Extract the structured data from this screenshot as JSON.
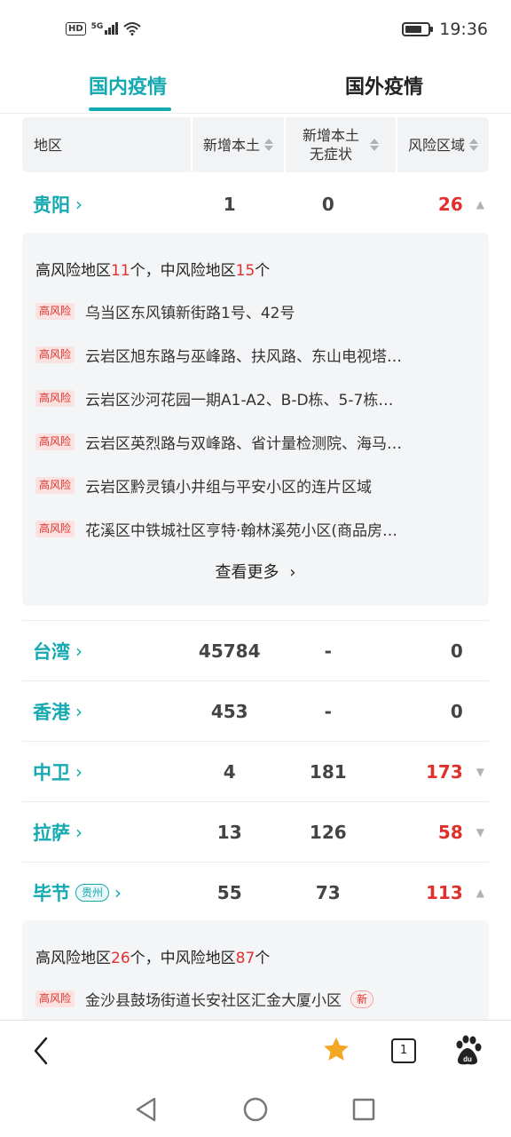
{
  "status_bar": {
    "hd": "HD",
    "network": "5G",
    "time": "19:36",
    "battery_level": 0.75
  },
  "tabs": [
    {
      "label": "国内疫情",
      "active": true
    },
    {
      "label": "国外疫情",
      "active": false
    }
  ],
  "table_header": {
    "region": "地区",
    "new_local": "新增本土",
    "new_asymptomatic_line1": "新增本土",
    "new_asymptomatic_line2": "无症状",
    "risk_areas": "风险区域"
  },
  "rows": [
    {
      "region": "贵阳",
      "new_local": "1",
      "asymptomatic": "0",
      "risk": "26",
      "risk_red": true,
      "expanded": true
    },
    {
      "region": "台湾",
      "new_local": "45784",
      "asymptomatic": "-",
      "risk": "0",
      "risk_red": false
    },
    {
      "region": "香港",
      "new_local": "453",
      "asymptomatic": "-",
      "risk": "0",
      "risk_red": false
    },
    {
      "region": "中卫",
      "new_local": "4",
      "asymptomatic": "181",
      "risk": "173",
      "risk_red": true
    },
    {
      "region": "拉萨",
      "new_local": "13",
      "asymptomatic": "126",
      "risk": "58",
      "risk_red": true
    },
    {
      "region": "毕节",
      "province_tag": "贵州",
      "new_local": "55",
      "asymptomatic": "73",
      "risk": "113",
      "risk_red": true,
      "expanded": true
    }
  ],
  "guiyang_panel": {
    "summary_prefix": "高风险地区",
    "high_count": "11",
    "summary_mid": "个，中风险地区",
    "mid_count": "15",
    "summary_suffix": "个",
    "badge": "高风险",
    "items": [
      "乌当区东风镇新街路1号、42号",
      "云岩区旭东路与巫峰路、扶风路、东山电视塔…",
      "云岩区沙河花园一期A1-A2、B-D栋、5-7栋…",
      "云岩区英烈路与双峰路、省计量检测院、海马…",
      "云岩区黔灵镇小井组与平安小区的连片区域",
      "花溪区中铁城社区亨特·翰林溪苑小区(商品房…"
    ],
    "see_more": "查看更多"
  },
  "bijie_panel": {
    "summary_prefix": "高风险地区",
    "high_count": "26",
    "summary_mid": "个，中风险地区",
    "mid_count": "87",
    "summary_suffix": "个",
    "badge": "高风险",
    "items": [
      "金沙县鼓场街道长安社区汇金大厦小区"
    ],
    "new_tag": "新"
  },
  "browser_bar": {
    "tab_count": "1",
    "icons": [
      "back-icon",
      "star-icon",
      "tabs-icon",
      "baidu-paw-icon"
    ]
  },
  "colors": {
    "accent": "#15a9b1",
    "danger": "#e0302c",
    "star": "#f5a623"
  }
}
